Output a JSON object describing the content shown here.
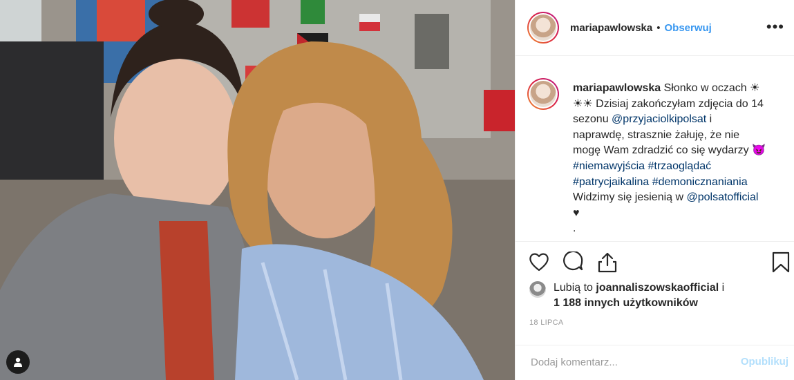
{
  "post": {
    "author": "mariapawlowska",
    "separator": "•",
    "follow_label": "Obserwuj",
    "more_label": "•••",
    "caption": {
      "username": "mariapawlowska",
      "text_1": " Słonko w oczach ☀",
      "text_2": "☀☀ Dzisiaj zakończyłam zdjęcia do 14",
      "text_3": "sezonu ",
      "mention_1": "@przyjaciolkipolsat",
      "text_4": " i",
      "text_5": "naprawdę, strasznie żałuję, że nie",
      "text_6": "mogę Wam zdradzić co się wydarzy 😈",
      "hashtag_1": "#niemawyjścia",
      "hashtag_2": "#trzaoglądać",
      "hashtag_3": "#patrycjaikalina",
      "hashtag_4": "#demonicznaniania",
      "text_7": "Widzimy się jesienią w ",
      "mention_2": "@polsatofficial",
      "text_8": "♥",
      "text_9": "."
    },
    "likes": {
      "prefix": "Lubią to ",
      "liker": "joannaliszowskaofficial",
      "connector": " i",
      "count_text": "1 188 innych użytkowników"
    },
    "date": "18 LIPCA",
    "comment": {
      "placeholder": "Dodaj komentarz...",
      "publish_label": "Opublikuj"
    }
  },
  "icons": {
    "like": "heart-icon",
    "comment": "comment-bubble-icon",
    "share": "share-icon",
    "save": "bookmark-icon",
    "tags": "user-tag-icon"
  },
  "colors": {
    "link": "#003569",
    "follow": "#3897f0",
    "publish_disabled": "#b2dffc"
  }
}
